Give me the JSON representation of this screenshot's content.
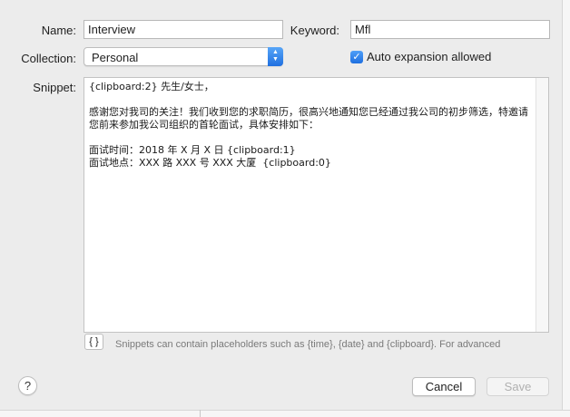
{
  "form": {
    "name_label": "Name:",
    "name_value": "Interview",
    "keyword_label": "Keyword:",
    "keyword_value": "Mfl",
    "collection_label": "Collection:",
    "collection_value": "Personal",
    "auto_expansion_label": "Auto expansion allowed",
    "auto_expansion_checked": true,
    "snippet_label": "Snippet:",
    "snippet_text": "{clipboard:2} 先生/女士，\n\n感谢您对我司的关注！我们收到您的求职简历，很高兴地通知您已经通过我公司的初步筛选，特邀请您前来参加我公司组织的首轮面试，具体安排如下：\n\n面试时间：2018 年 X 月 X 日 {clipboard:1}\n面试地点：XXX 路 XXX 号 XXX 大厦  {clipboard:0}",
    "placeholder_button": "{ }",
    "hint": "Snippets can contain placeholders such as {time}, {date} and {clipboard}. For advanced"
  },
  "footer": {
    "help": "?",
    "cancel": "Cancel",
    "save": "Save"
  },
  "colors": {
    "accent": "#1e6fe0",
    "background": "#ececec"
  }
}
